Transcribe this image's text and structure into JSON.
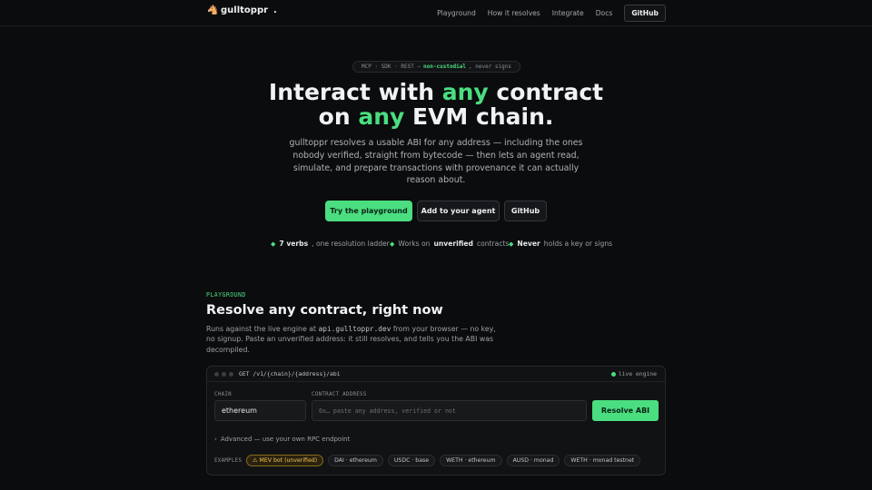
{
  "header": {
    "brand": "gulltoppr",
    "brand_suffix": ".",
    "logo_icon": "horse-head-icon",
    "nav": [
      "Playground",
      "How it resolves",
      "Integrate",
      "Docs"
    ],
    "github": "GitHub"
  },
  "hero": {
    "pill_prefix": "MCP · SDK · REST —",
    "pill_highlight": "non-custodial",
    "pill_suffix": ", never signs",
    "title_1": "Interact with ",
    "title_acc_1": "any",
    "title_2": " contract",
    "title_3": "on ",
    "title_acc_2": "any",
    "title_4": " EVM chain.",
    "subtitle": "gulltoppr resolves a usable ABI for any address — including the ones nobody verified, straight from bytecode — then lets an agent read, simulate, and prepare transactions with provenance it can actually reason about.",
    "cta_primary": "Try the playground",
    "cta_secondary": "Add to your agent",
    "cta_github": "GitHub",
    "features": [
      {
        "bold": "7 verbs",
        "text": ", one resolution ladder"
      },
      {
        "pre": "Works on ",
        "bold": "unverified",
        "text": " contracts"
      },
      {
        "bold": "Never",
        "text": " holds a key or signs"
      }
    ],
    "accent_color": "#4ade80"
  },
  "playground": {
    "eyebrow": "PLAYGROUND",
    "title": "Resolve any contract, right now",
    "sub_1": "Runs against the live engine at ",
    "sub_code": "api.gulltoppr.dev",
    "sub_2": " from your browser — no key, no signup. Paste an unverified address: it still resolves, and tells you the ABI was decompiled.",
    "endpoint": "GET /v1/{chain}/{address}/abi",
    "live": "live engine",
    "chain_label": "CHAIN",
    "chain_value": "ethereum",
    "address_label": "CONTRACT ADDRESS",
    "address_placeholder": "0x… paste any address, verified or not",
    "resolve": "Resolve ABI",
    "advanced": "Advanced — use your own RPC endpoint",
    "examples_label": "EXAMPLES",
    "examples": [
      "⚠ MEV bot (unverified)",
      "DAI · ethereum",
      "USDC · base",
      "WETH · ethereum",
      "AUSD · monad",
      "WETH · monad testnet"
    ]
  }
}
